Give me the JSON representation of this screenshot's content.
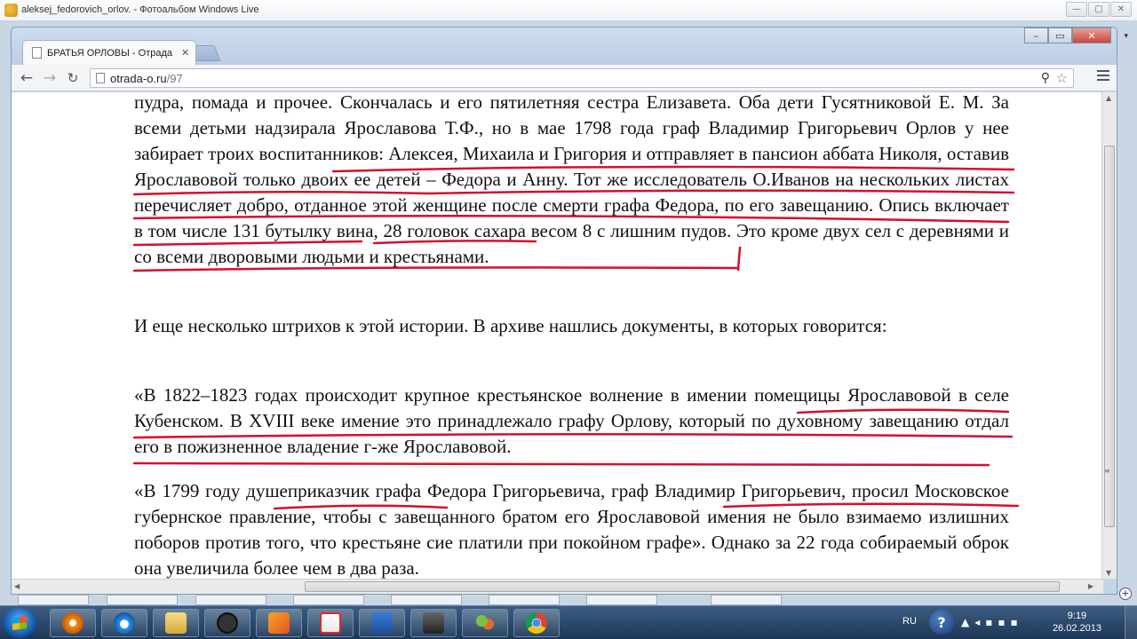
{
  "outer_window": {
    "title": "aleksej_fedorovich_orlov. - Фотоальбом Windows Live"
  },
  "browser": {
    "tab_title": "БРАТЬЯ ОРЛОВЫ - Отрадa",
    "url_host": "otrada-o.ru",
    "url_path": "/97"
  },
  "article": {
    "p1": "пудра, помада и прочее. Скончалась и его пятилетняя сестра Елизавета.  Оба дети Гусятниковой Е. М. За всеми детьми надзирала Ярославова Т.Ф., но в мае 1798 года граф Владимир Григорьевич Орлов  у нее забирает троих воспитанников: Алексея, Михаила и Григория и отправляет в пансион аббата Николя, оставив Ярославовой только двоих ее детей – Федора и Анну. Тот же исследователь О.Иванов на нескольких листах перечисляет добро, отданное этой женщине после смерти графа Федора, по его завещанию. Опись включает в том числе 131 бутылку вина, 28 головок сахара весом 8 с лишним пудов. Это кроме двух сел с деревнями и со всеми дворовыми людьми и крестьянами.",
    "p2": " И еще несколько штрихов к этой истории. В архиве нашлись документы, в которых говорится:",
    "p3": "«В 1822–1823 годах происходит крупное крестьянское волнение в имении помещицы Ярославовой в селе Кубенском. В XVIII веке имение это принадлежало графу Орлову, который по духовному завещанию отдал его в пожизненное владение г-же Ярославовой.",
    "p4": "«В 1799 году душеприказчик графа Федора Григорьевича, граф Владимир Григорьевич, просил Московское губернское правление, чтобы с завещанного братом его Ярославовой имения не было взимаемо излишних поборов против того, что крестьяне сие платили при покойном графе».  Однако за 22 года собираемый оброк она увеличила более чем в два раза."
  },
  "taskbar": {
    "language": "RU",
    "time": "9:19",
    "date": "26.02.2013"
  },
  "colors": {
    "annotation_red": "#d4102a",
    "taskbar": "#1d3656"
  }
}
